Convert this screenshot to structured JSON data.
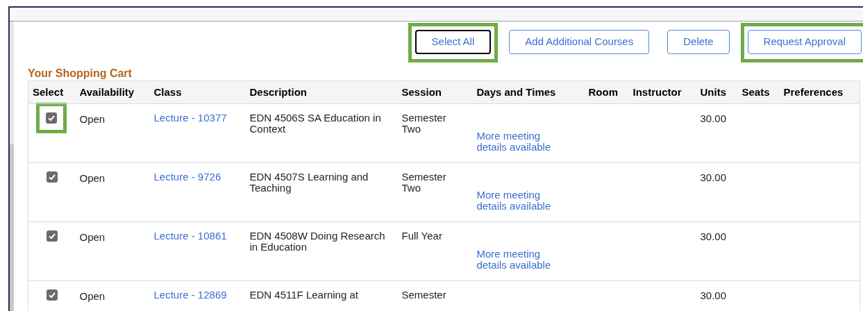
{
  "toolbar": {
    "buttons": [
      {
        "label": "Select All",
        "focused": true,
        "highlighted": true
      },
      {
        "label": "Add Additional Courses",
        "focused": false,
        "highlighted": false
      },
      {
        "label": "Delete",
        "focused": false,
        "highlighted": false
      },
      {
        "label": "Request Approval",
        "focused": false,
        "highlighted": true
      }
    ]
  },
  "cart": {
    "title": "Your Shopping Cart",
    "columns": [
      "Select",
      "Availability",
      "Class",
      "Description",
      "Session",
      "Days and Times",
      "Room",
      "Instructor",
      "Units",
      "Seats",
      "Preferences"
    ],
    "rows": [
      {
        "checked": true,
        "highlighted": true,
        "availability": "Open",
        "class": "Lecture - 10377",
        "description": "EDN 4506S SA Education in Context",
        "session": "Semester Two",
        "days_and_times": "More meeting details available",
        "units": "30.00"
      },
      {
        "checked": true,
        "highlighted": false,
        "availability": "Open",
        "class": "Lecture - 9726",
        "description": "EDN 4507S Learning and Teaching",
        "session": "Semester Two",
        "days_and_times": "More meeting details available",
        "units": "30.00"
      },
      {
        "checked": true,
        "highlighted": false,
        "availability": "Open",
        "class": "Lecture - 10861",
        "description": "EDN 4508W Doing Research in Education",
        "session": "Full Year",
        "days_and_times": "More meeting details available",
        "units": "30.00"
      },
      {
        "checked": true,
        "highlighted": false,
        "availability": "Open",
        "class": "Lecture - 12869",
        "description": "EDN 4511F Learning at",
        "session": "Semester",
        "units": "30.00"
      }
    ]
  }
}
